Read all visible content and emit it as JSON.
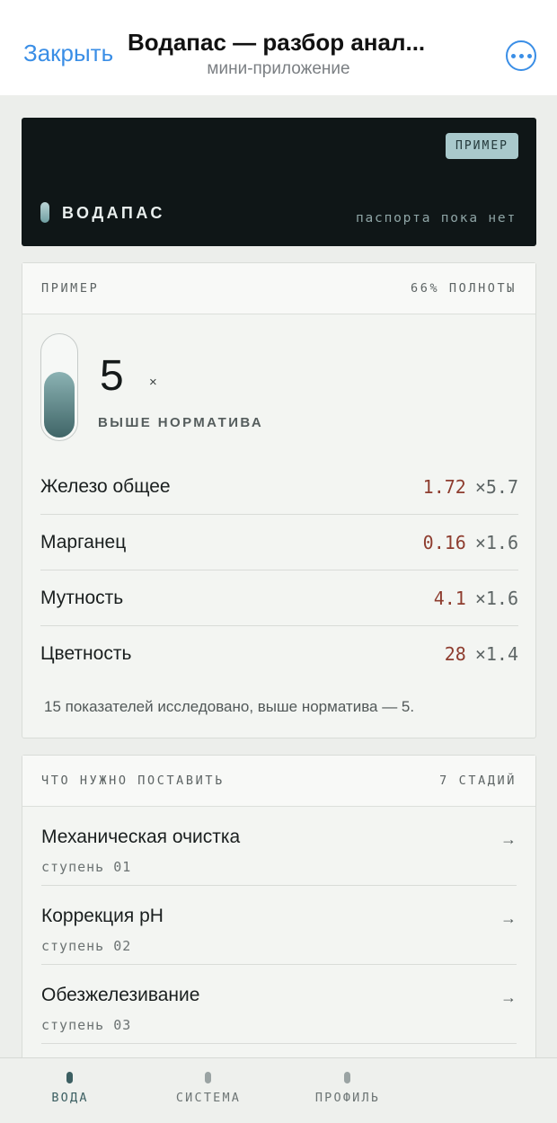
{
  "navbar": {
    "close_label": "Закрыть",
    "title": "Водапас — разбор анал...",
    "subtitle": "мини-приложение",
    "more_icon": "ellipsis-circle-icon"
  },
  "hero": {
    "badge": "ПРИМЕР",
    "brand": "ВОДАПАС",
    "note": "паспорта пока нет"
  },
  "analysis": {
    "header_left": "ПРИМЕР",
    "header_right": "66% ПОЛНОТЫ",
    "completeness_fraction": 0.66,
    "count": "5",
    "count_unit": "×",
    "count_label": "ВЫШЕ НОРМАТИВА",
    "rows": [
      {
        "name": "Железо общее",
        "value": "1.72",
        "mult": "×5.7"
      },
      {
        "name": "Марганец",
        "value": "0.16",
        "mult": "×1.6"
      },
      {
        "name": "Мутность",
        "value": "4.1",
        "mult": "×1.6"
      },
      {
        "name": "Цветность",
        "value": "28",
        "mult": "×1.4"
      }
    ],
    "footnote": "15 показателей исследовано, выше норматива — 5."
  },
  "stages": {
    "header_left": "ЧТО НУЖНО ПОСТАВИТЬ",
    "header_right": "7 СТАДИЙ",
    "arrow_icon": "arrow-right-icon",
    "items": [
      {
        "title": "Механическая очистка",
        "step": "ступень 01"
      },
      {
        "title": "Коррекция pH",
        "step": "ступень 02"
      },
      {
        "title": "Обезжелезивание",
        "step": "ступень 03"
      }
    ]
  },
  "tabs": [
    {
      "label": "ВОДА",
      "active": true
    },
    {
      "label": "СИСТЕМА",
      "active": false
    },
    {
      "label": "ПРОФИЛЬ",
      "active": false
    }
  ],
  "colors": {
    "accent_blue": "#3a8ee6",
    "exceed_red": "#8e3d2f",
    "hero_bg": "#0f1617",
    "teal": "#3c5f62"
  }
}
